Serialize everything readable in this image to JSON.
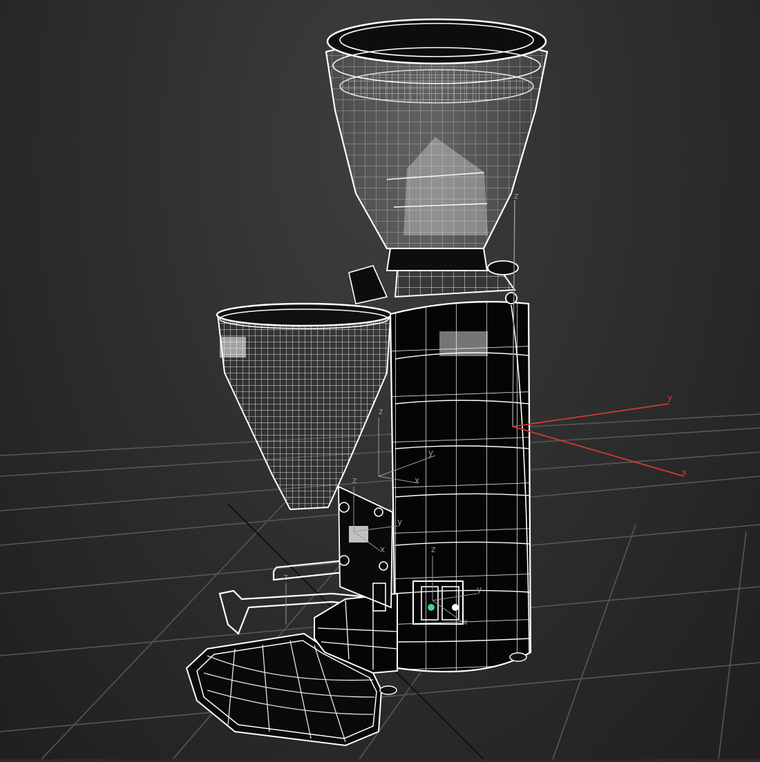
{
  "viewport": {
    "background_color": "#2b2b2b",
    "wire_color": "#ffffff",
    "grid_color": "#5a5a5a",
    "solid_fill": "#050505"
  },
  "gizmos": {
    "axis_color_red": "#d03a2f",
    "axis_color_gray": "#9a9a9a",
    "labels": {
      "x": "x",
      "y": "y",
      "z": "z"
    }
  }
}
